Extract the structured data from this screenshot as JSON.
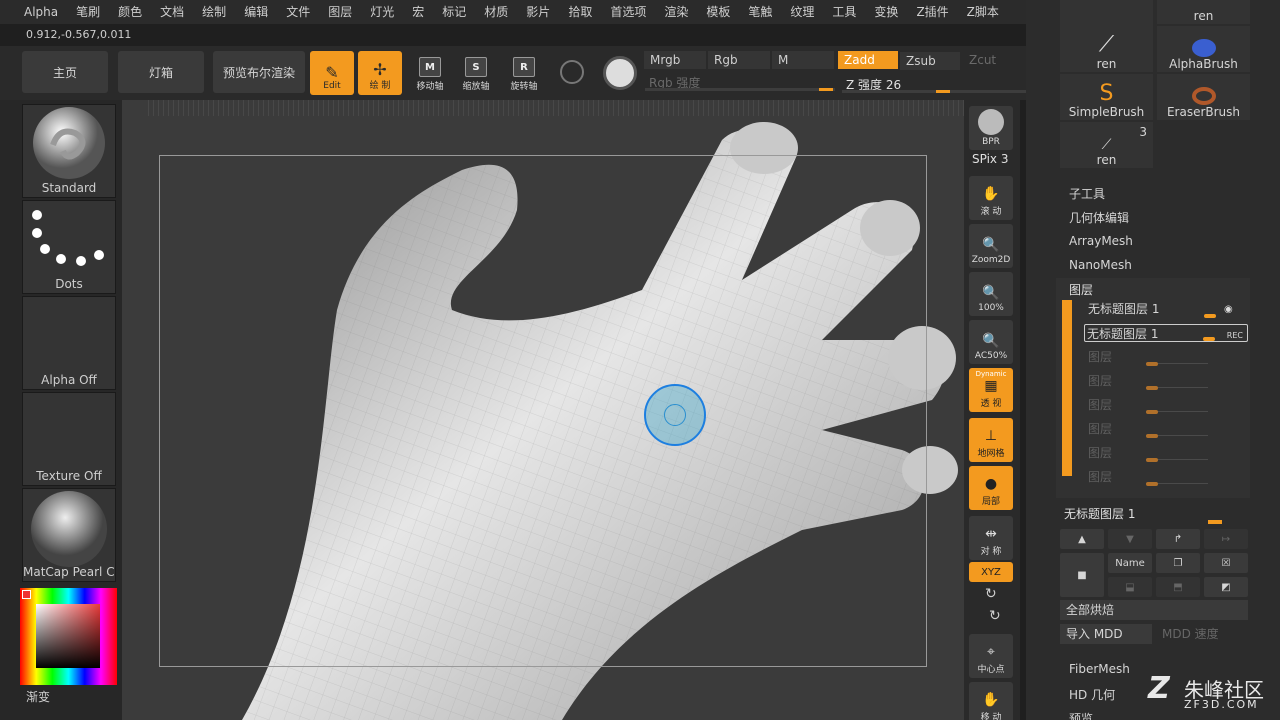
{
  "menu": [
    "Alpha",
    "笔刷",
    "颜色",
    "文档",
    "绘制",
    "编辑",
    "文件",
    "图层",
    "灯光",
    "宏",
    "标记",
    "材质",
    "影片",
    "拾取",
    "首选项",
    "渲染",
    "模板",
    "笔触",
    "纹理",
    "工具",
    "变换",
    "Z插件",
    "Z脚本"
  ],
  "coords": "0.912,-0.567,0.011",
  "shelf": {
    "home": "主页",
    "lightbox": "灯箱",
    "bpr_preview": "预览布尔渲染",
    "edit": "Edit",
    "draw": "绘 制",
    "move": "移动轴",
    "scale": "缩放轴",
    "rotate": "旋转轴",
    "move_glyph": "M",
    "scale_glyph": "S",
    "rotate_glyph": "R",
    "mrgb": "Mrgb",
    "rgb": "Rgb",
    "m": "M",
    "zadd": "Zadd",
    "zsub": "Zsub",
    "zcut": "Zcut",
    "rgb_intensity": "Rgb 强度",
    "z_intensity_label": "Z 强度",
    "z_intensity": "26",
    "z_intensity_fraction": 0.26
  },
  "left": {
    "brush": "Standard",
    "stroke": "Dots",
    "alpha": "Alpha Off",
    "texture": "Texture Off",
    "material": "MatCap Pearl Ca",
    "gradient": "渐变"
  },
  "rbar": {
    "bpr": "BPR",
    "spix": "SPix 3",
    "scroll": "滚 动",
    "zoom2d": "Zoom2D",
    "actual": "100%",
    "ac50": "AC50%",
    "dynamic": "Dynamic",
    "persp": "透 视",
    "floor": "地网格",
    "local": "局部 ",
    "sym": "对 称",
    "xyz": "XYZ",
    "center": "中心点",
    "move": "移 动"
  },
  "tray": {
    "brushes": [
      {
        "label": "ren"
      },
      {
        "label": "ren"
      },
      {
        "label": "AlphaBrush"
      },
      {
        "label": "SimpleBrush"
      },
      {
        "label": "EraserBrush"
      },
      {
        "label": "ren",
        "count": "3"
      }
    ],
    "list": [
      "子工具",
      "几何体编辑",
      "ArrayMesh",
      "NanoMesh"
    ],
    "layers_title": "图层",
    "layer1": "无标题图层 1",
    "layer2": "无标题图层 1",
    "rec": "REC",
    "layer_empty": "图层",
    "current_layer": "无标题图层 1",
    "name": "Name",
    "bake_all": "全部烘焙",
    "import_mdd": "导入 MDD",
    "mdd_speed": "MDD 速度",
    "fibermesh": "FiberMesh",
    "hd_geo": "HD 几何",
    "preview": "预览"
  },
  "watermark": {
    "name": "朱峰社区",
    "url": "ZF3D.COM"
  }
}
